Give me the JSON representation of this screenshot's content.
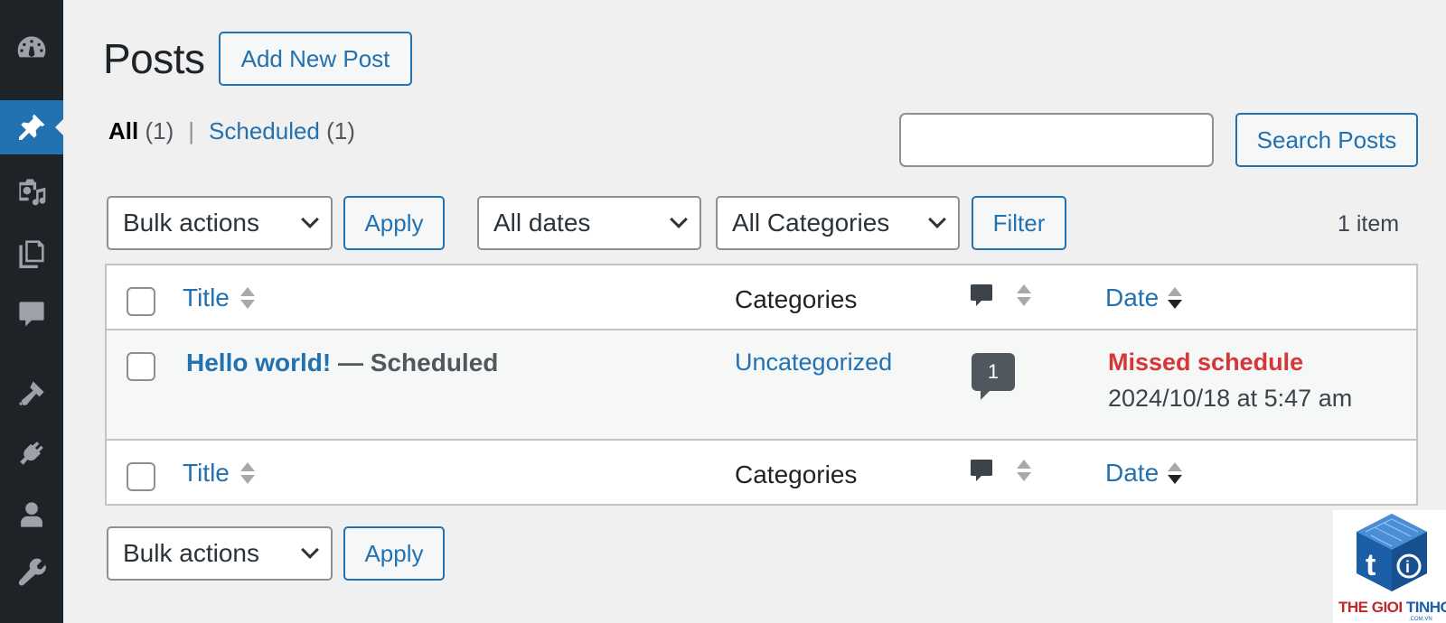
{
  "sidebar": {
    "items": [
      {
        "icon": "dashboard-icon",
        "active": false
      },
      {
        "icon": "pushpin-icon",
        "active": true
      },
      {
        "icon": "media-icon",
        "active": false
      },
      {
        "icon": "pages-icon",
        "active": false
      },
      {
        "icon": "comments-icon",
        "active": false
      },
      {
        "icon": "appearance-brush-icon",
        "active": false
      },
      {
        "icon": "plugins-icon",
        "active": false
      },
      {
        "icon": "users-icon",
        "active": false
      },
      {
        "icon": "tools-wrench-icon",
        "active": false
      }
    ],
    "active_color": "#2271b1",
    "background": "#1d2327"
  },
  "header": {
    "title": "Posts",
    "add_new_label": "Add New Post"
  },
  "views": {
    "all_label": "All",
    "all_count": "(1)",
    "separator": "|",
    "scheduled_label": "Scheduled",
    "scheduled_count": "(1)"
  },
  "search": {
    "value": "",
    "button_label": "Search Posts"
  },
  "top_nav": {
    "bulk_actions": "Bulk actions",
    "apply_label": "Apply",
    "date_filter": "All dates",
    "category_filter": "All Categories",
    "filter_label": "Filter",
    "item_count": "1 item"
  },
  "table": {
    "columns": {
      "title": "Title",
      "categories": "Categories",
      "comments_icon": "comment-bubble-icon",
      "date": "Date"
    },
    "rows": [
      {
        "title": "Hello world!",
        "state": " — Scheduled",
        "category": "Uncategorized",
        "comments": "1",
        "date_status": "Missed schedule",
        "date_value": "2024/10/18 at 5:47 am"
      }
    ]
  },
  "bottom_nav": {
    "bulk_actions": "Bulk actions",
    "apply_label": "Apply"
  },
  "watermark": {
    "brand_red": "THE GIOI ",
    "brand_blue": "TINHOC",
    "domain": ".COM.VN",
    "colors": {
      "red": "#c0272d",
      "blue": "#1a5ea8"
    }
  }
}
